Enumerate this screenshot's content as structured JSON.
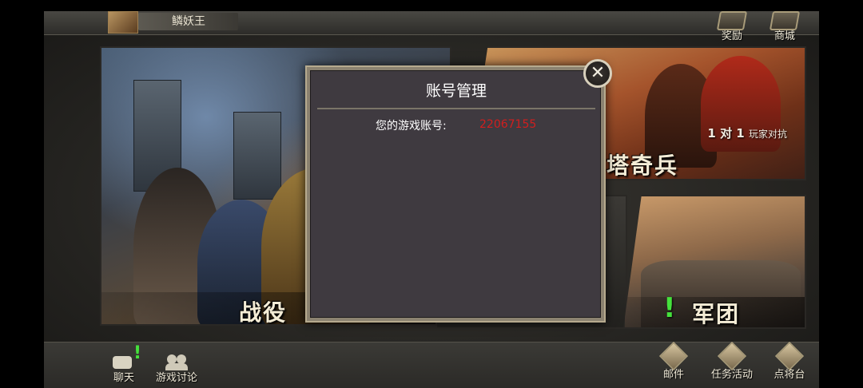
{
  "topbar": {
    "player_name": "鳞妖王",
    "reward_label": "奖励",
    "shop_label": "商城"
  },
  "modes": {
    "campaign_title": "战役",
    "pvp_title": "塔奇兵",
    "pvp_subtitle_main": "1 对 1",
    "pvp_subtitle_small": "玩家对抗",
    "legion_title": "军团",
    "legion_alert": "!"
  },
  "dialog": {
    "title": "账号管理",
    "account_label": "您的游戏账号:",
    "account_value": "22067155",
    "close_glyph": "✕"
  },
  "bottombar": {
    "chat_label": "聊天",
    "chat_alert": "!",
    "forum_label": "游戏讨论",
    "mail_label": "邮件",
    "tasks_label": "任务活动",
    "general_label": "点将台"
  },
  "colors": {
    "account_value": "#d21e1e",
    "alert_green": "#45e23c",
    "dialog_bg": "#3f3a40"
  }
}
